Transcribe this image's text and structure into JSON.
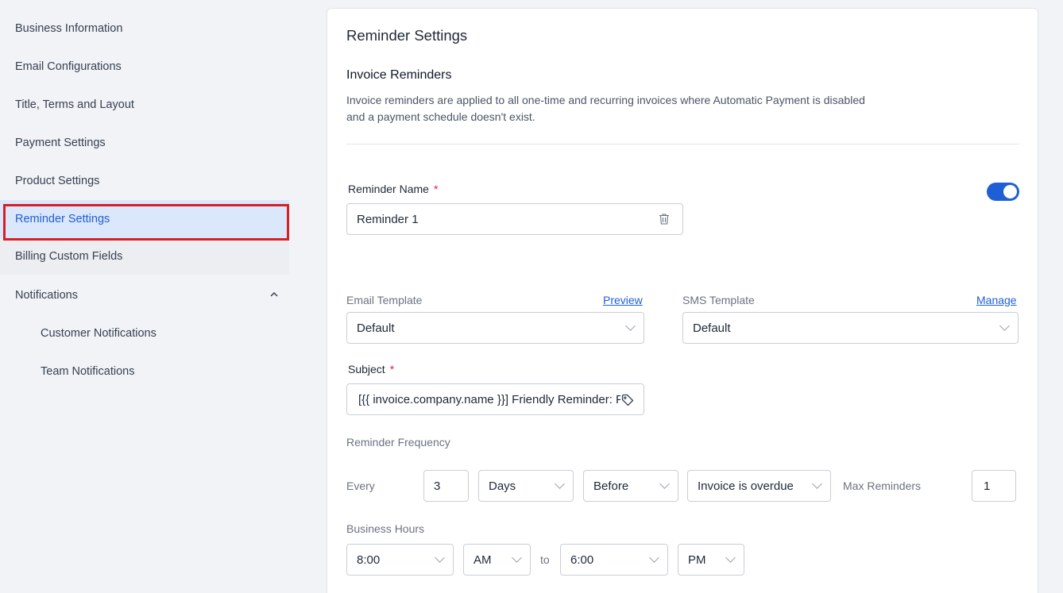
{
  "sidebar": {
    "items": [
      {
        "label": "Business Information"
      },
      {
        "label": "Email Configurations"
      },
      {
        "label": "Title, Terms and Layout"
      },
      {
        "label": "Payment Settings"
      },
      {
        "label": "Product Settings"
      },
      {
        "label": "Reminder Settings"
      },
      {
        "label": "Billing Custom Fields"
      },
      {
        "label": "Notifications"
      },
      {
        "label": "Customer Notifications"
      },
      {
        "label": "Team Notifications"
      }
    ],
    "active_item": "Reminder Settings"
  },
  "card": {
    "title": "Reminder Settings",
    "section_title": "Invoice Reminders",
    "description": "Invoice reminders are applied to all one-time and recurring invoices where Automatic Payment is disabled and a payment schedule doesn't exist.",
    "reminder_name_label": "Reminder Name",
    "required_mark": "*",
    "reminder_name_value": "Reminder 1",
    "reminder_enabled": true,
    "email_template_label": "Email Template",
    "email_template_link": "Preview",
    "email_template_value": "Default",
    "sms_template_label": "SMS Template",
    "sms_template_link": "Manage",
    "sms_template_value": "Default",
    "subject_label": "Subject",
    "subject_value": "[{{ invoice.company.name }}] Friendly Reminder: Payment Due",
    "frequency_label": "Reminder Frequency",
    "every_label": "Every",
    "every_value": "3",
    "unit_value": "Days",
    "relation_value": "Before",
    "event_value": "Invoice is overdue",
    "max_reminders_label": "Max Reminders",
    "max_reminders_value": "1",
    "business_hours_label": "Business Hours",
    "start_time": "8:00",
    "start_period": "AM",
    "to_label": "to",
    "end_time": "6:00",
    "end_period": "PM"
  },
  "colors": {
    "accent": "#1f5fd6",
    "active_bg": "#dbe7fa",
    "highlight_border": "#d91f26",
    "required": "#e11d48"
  }
}
